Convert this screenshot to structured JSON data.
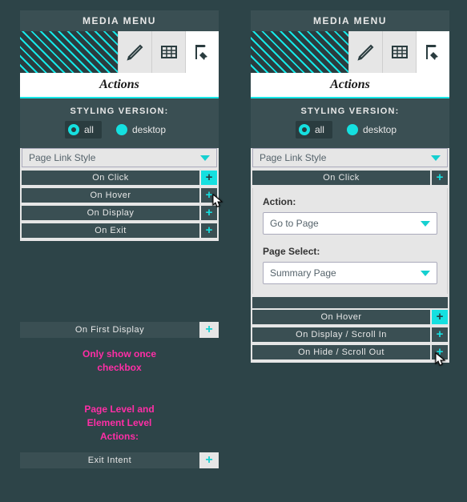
{
  "panels": {
    "title": "MEDIA MENU",
    "actions_header": "Actions",
    "styling_label": "STYLING VERSION:",
    "radio_all": "all",
    "radio_desktop": "desktop",
    "style_dropdown": "Page Link Style"
  },
  "left_events": {
    "on_click": "On Click",
    "on_hover": "On Hover",
    "on_display": "On Display",
    "on_exit": "On Exit",
    "on_first_display": "On First Display",
    "exit_intent": "Exit Intent"
  },
  "right_events": {
    "on_click": "On Click",
    "on_hover": "On Hover",
    "on_display_scroll_in": "On Display / Scroll In",
    "on_hide_scroll_out": "On Hide / Scroll Out"
  },
  "action_form": {
    "action_label": "Action:",
    "action_value": "Go to Page",
    "page_select_label": "Page Select:",
    "page_select_value": "Summary Page"
  },
  "notes": {
    "only_show_once": "Only show once\ncheckbox",
    "page_level": "Page Level and\nElement Level\nActions:"
  },
  "icons": {
    "brush": "brush-icon",
    "grid": "grid-icon",
    "flag": "flag-cursor-icon"
  }
}
